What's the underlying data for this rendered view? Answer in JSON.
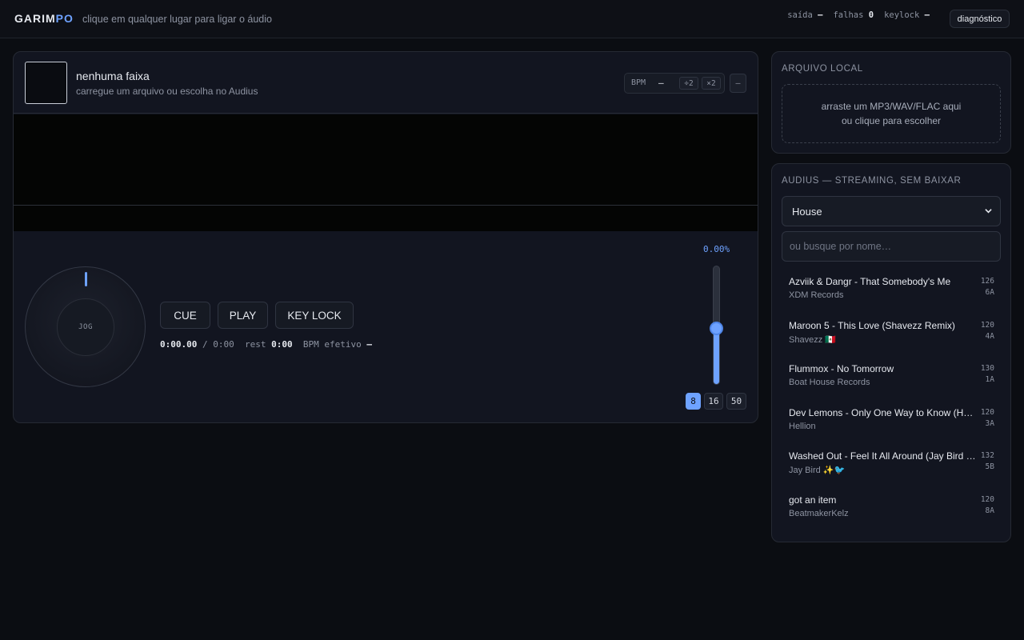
{
  "header": {
    "logo_main": "GARIM",
    "logo_accent": "PO",
    "hint": "clique em qualquer lugar para ligar o áudio",
    "status": [
      {
        "label": "saída",
        "value": "–"
      },
      {
        "label": "falhas",
        "value": "0"
      },
      {
        "label": "keylock",
        "value": "–"
      }
    ],
    "diag_label": "diagnóstico"
  },
  "deck": {
    "title": "nenhuma faixa",
    "subtitle": "carregue um arquivo ou escolha no Audius",
    "bpm_label": "BPM",
    "bpm_value": "–",
    "half_label": "÷2",
    "double_label": "×2",
    "extra_label": "–",
    "jog_label": "JOG",
    "buttons": {
      "cue": "CUE",
      "play": "PLAY",
      "keylock": "KEY LOCK"
    },
    "time": {
      "position": "0:00.00",
      "sep": " / ",
      "duration": "0:00",
      "rest_label": "  rest ",
      "rest": "0:00",
      "bpm_eff_label": "  BPM efetivo ",
      "bpm_eff": "–"
    },
    "pitch": {
      "percent": "0.00%",
      "level": 0.5,
      "ranges": [
        "8",
        "16",
        "50"
      ],
      "active_range": "8"
    }
  },
  "local": {
    "title": "ARQUIVO LOCAL",
    "drop_line1": "arraste um MP3/WAV/FLAC aqui",
    "drop_line2": "ou clique para escolher"
  },
  "audius": {
    "title": "AUDIUS — STREAMING, SEM BAIXAR",
    "genre": "House",
    "search_placeholder": "ou busque por nome…",
    "tracks": [
      {
        "title": "Azviik & Dangr - That Somebody's Me",
        "artist": "XDM Records",
        "bpm": "126",
        "key": "6A"
      },
      {
        "title": "Maroon 5 - This Love (Shavezz Remix)",
        "artist": "Shavezz 🇲🇽",
        "bpm": "120",
        "key": "4A"
      },
      {
        "title": "Flummox - No Tomorrow",
        "artist": "Boat House Records",
        "bpm": "130",
        "key": "1A"
      },
      {
        "title": "Dev Lemons - Only One Way to Know (Hellion Remix)",
        "artist": "Hellion",
        "bpm": "120",
        "key": "3A"
      },
      {
        "title": "Washed Out - Feel It All Around (Jay Bird Remix)",
        "artist": "Jay Bird ✨🐦",
        "bpm": "132",
        "key": "5B"
      },
      {
        "title": "got an item",
        "artist": "BeatmakerKelz",
        "bpm": "120",
        "key": "8A"
      }
    ]
  },
  "colors": {
    "accent": "#6ea2ff",
    "background": "#0b0d12",
    "panel": "#121520"
  }
}
